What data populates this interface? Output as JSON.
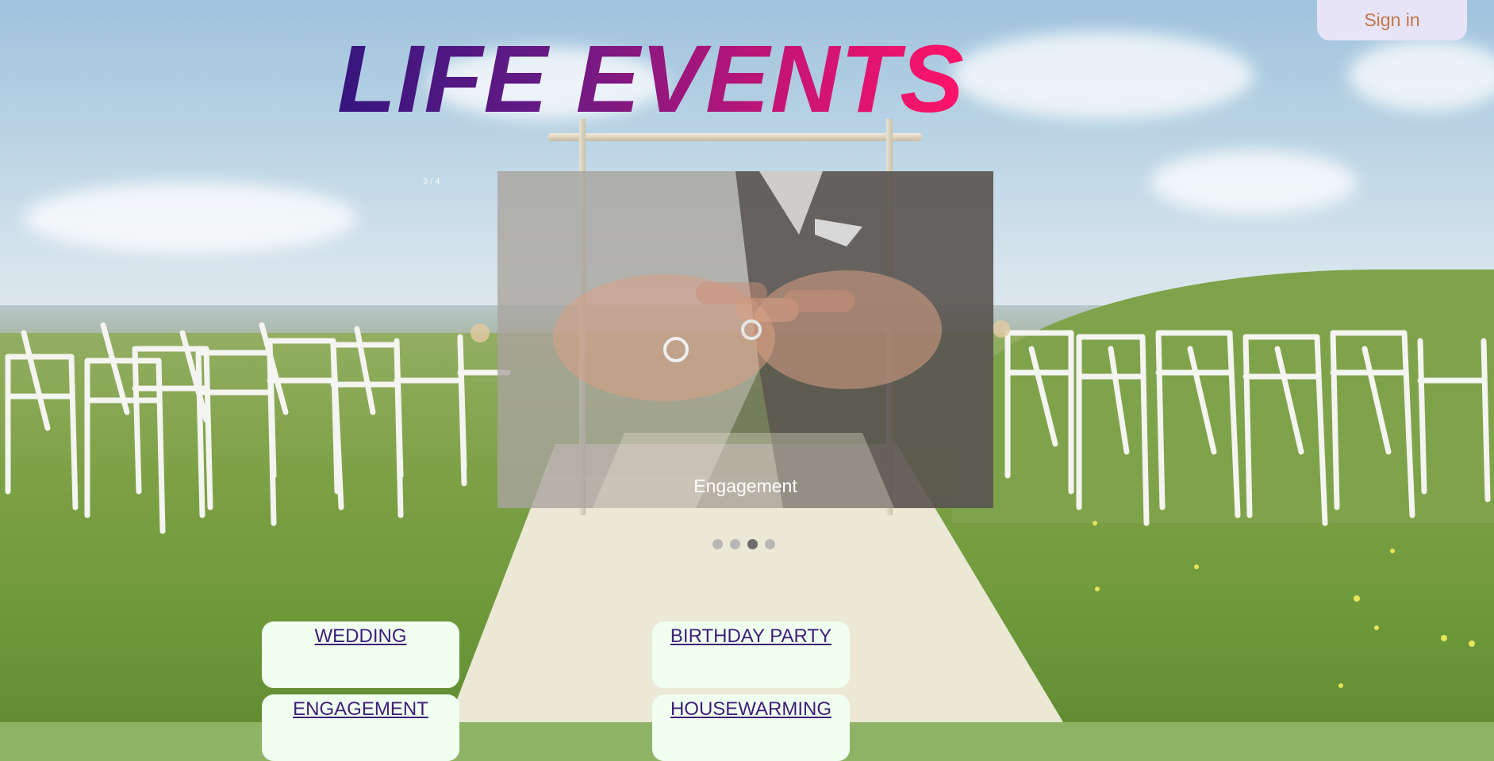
{
  "header": {
    "title": "LIFE EVENTS",
    "sign_in_label": "Sign in"
  },
  "slideshow": {
    "counter": "3 / 4",
    "caption": "Engagement",
    "total_slides": 4,
    "active_slide": 3
  },
  "events": [
    {
      "label": "WEDDING"
    },
    {
      "label": "BIRTHDAY PARTY"
    },
    {
      "label": "ENGAGEMENT"
    },
    {
      "label": "HOUSEWARMING"
    }
  ],
  "colors": {
    "title_gradient_start": "#35157e",
    "title_gradient_end": "#ff1468",
    "sign_in_bg": "#e8e4f7",
    "sign_in_text": "#c1774a",
    "card_bg": "#f0fff0",
    "link_color": "#3d1f78"
  }
}
